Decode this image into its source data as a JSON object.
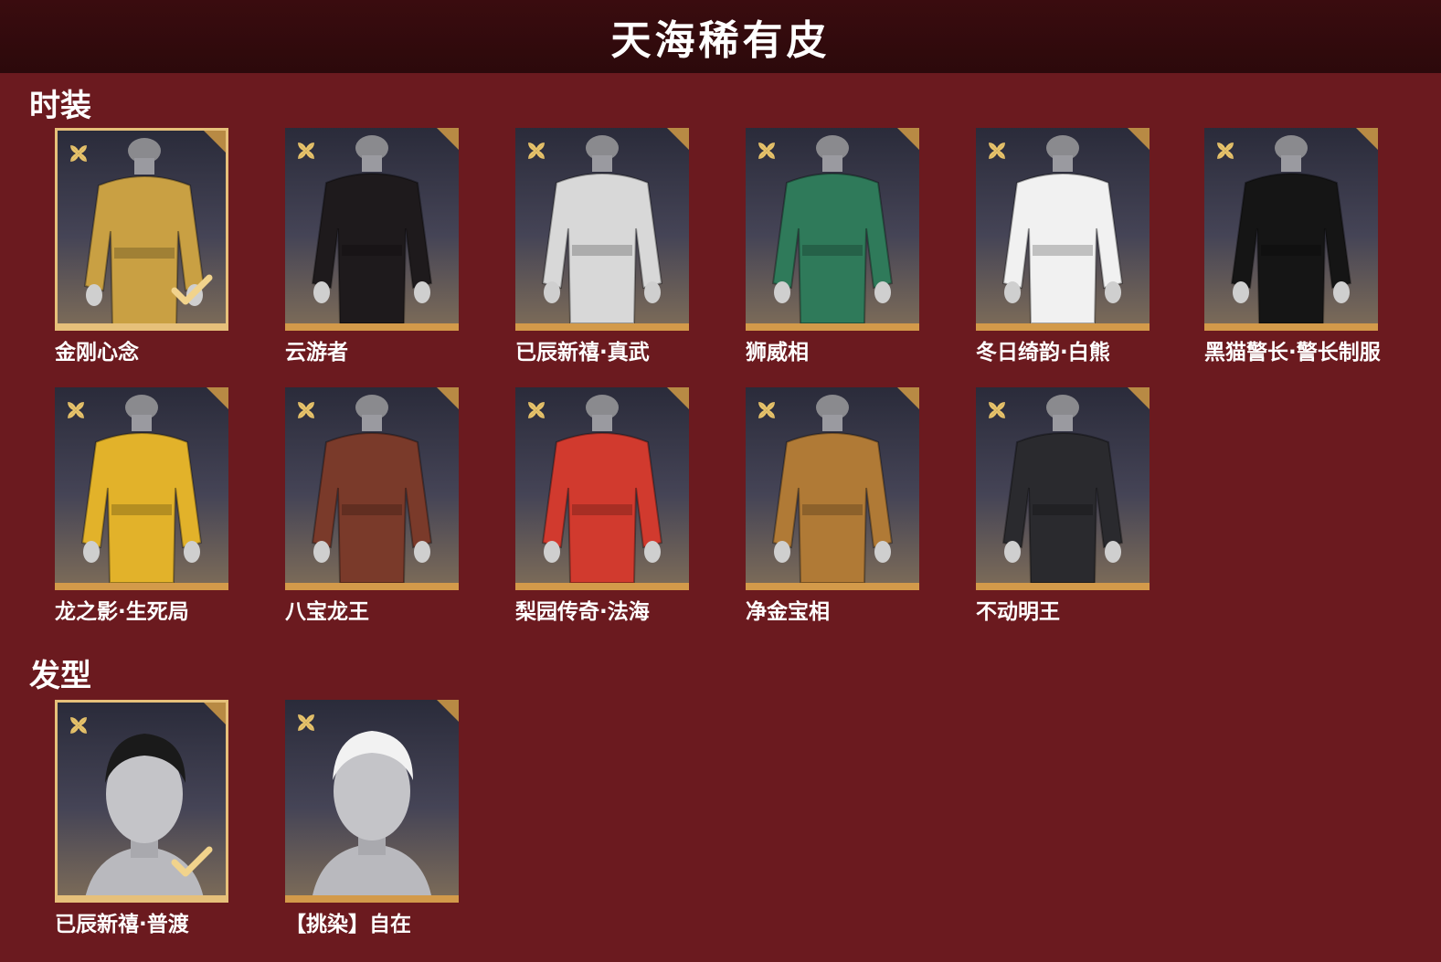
{
  "header": {
    "title": "天海稀有皮"
  },
  "sections": {
    "outfits": {
      "title": "时装",
      "items": [
        {
          "name": "金刚心念",
          "selected": true,
          "color": "#c9a043"
        },
        {
          "name": "云游者",
          "selected": false,
          "color": "#1e1a1c"
        },
        {
          "name": "已辰新禧·真武",
          "selected": false,
          "color": "#d8d8d8"
        },
        {
          "name": "狮威相",
          "selected": false,
          "color": "#2f7a5a"
        },
        {
          "name": "冬日绮韵·白熊",
          "selected": false,
          "color": "#f1f1f1"
        },
        {
          "name": "黑猫警长·警长制服",
          "selected": false,
          "color": "#151515"
        },
        {
          "name": "龙之影·生死局",
          "selected": false,
          "color": "#e2b22a"
        },
        {
          "name": "八宝龙王",
          "selected": false,
          "color": "#7a3a2a"
        },
        {
          "name": "梨园传奇·法海",
          "selected": false,
          "color": "#d13a2e"
        },
        {
          "name": "净金宝相",
          "selected": false,
          "color": "#b07a36"
        },
        {
          "name": "不动明王",
          "selected": false,
          "color": "#2a2a2e"
        }
      ]
    },
    "hair": {
      "title": "发型",
      "items": [
        {
          "name": "已辰新禧·普渡",
          "selected": true,
          "color": "#1a1a1a"
        },
        {
          "name": "【挑染】自在",
          "selected": false,
          "color": "#f2f2f2"
        }
      ]
    }
  },
  "colors": {
    "background": "#6b1a1f",
    "header": "#2c090b",
    "accent": "#d39a4a"
  }
}
